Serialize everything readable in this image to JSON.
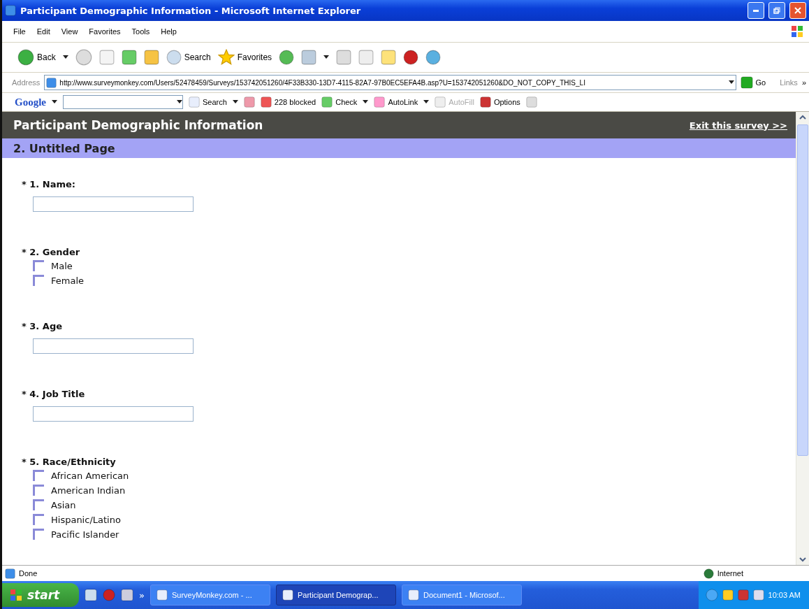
{
  "window": {
    "title": "Participant Demographic Information - Microsoft Internet Explorer"
  },
  "menu": [
    "File",
    "Edit",
    "View",
    "Favorites",
    "Tools",
    "Help"
  ],
  "toolbar": {
    "back": "Back",
    "search": "Search",
    "favorites": "Favorites"
  },
  "address": {
    "label": "Address",
    "url": "http://www.surveymonkey.com/Users/52478459/Surveys/153742051260/4F33B330-13D7-4115-82A7-97B0EC5EFA4B.asp?U=153742051260&DO_NOT_COPY_THIS_LI",
    "go": "Go",
    "links": "Links",
    "more": "»"
  },
  "google_bar": {
    "logo": "Google",
    "search": "Search",
    "blocked": "228 blocked",
    "check": "Check",
    "autolink": "AutoLink",
    "autofill": {
      "label": "AutoFill",
      "disabled": true
    },
    "options": "Options"
  },
  "survey": {
    "title": "Participant Demographic Information",
    "exit": "Exit this survey >>",
    "page": "2. Untitled Page",
    "questions": [
      {
        "label": "* 1. Name:",
        "kind": "text"
      },
      {
        "label": "* 2. Gender",
        "kind": "choice",
        "options": [
          {
            "label": "Male",
            "checked": false
          },
          {
            "label": "Female",
            "checked": false
          }
        ]
      },
      {
        "label": "* 3. Age",
        "kind": "text"
      },
      {
        "label": "* 4. Job Title",
        "kind": "text"
      },
      {
        "label": "* 5. Race/Ethnicity",
        "kind": "choice",
        "options": [
          {
            "label": "African American",
            "checked": false
          },
          {
            "label": "American Indian",
            "checked": false
          },
          {
            "label": "Asian",
            "checked": false
          },
          {
            "label": "Hispanic/Latino",
            "checked": false
          },
          {
            "label": "Pacific Islander",
            "checked": false
          }
        ]
      }
    ]
  },
  "status_bar": {
    "text": "Done",
    "zone": "Internet"
  },
  "taskbar": {
    "start": "start",
    "more": "»",
    "tasks": [
      {
        "label": "SurveyMonkey.com - ...",
        "selected": false
      },
      {
        "label": "Participant Demograp...",
        "selected": true
      },
      {
        "label": "Document1 - Microsof...",
        "selected": false
      }
    ],
    "clock": "10:03 AM"
  }
}
